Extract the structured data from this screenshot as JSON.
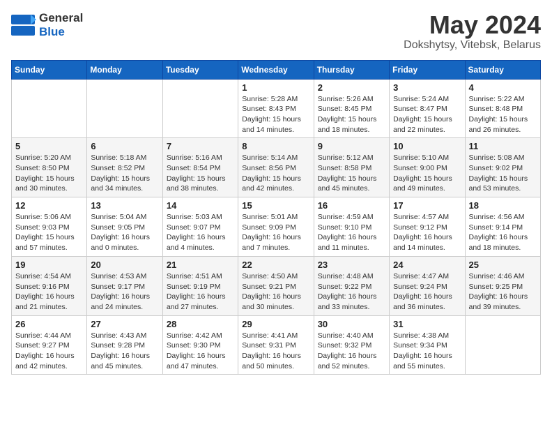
{
  "header": {
    "logo": {
      "general": "General",
      "blue": "Blue"
    },
    "title": "May 2024",
    "location": "Dokshytsy, Vitebsk, Belarus"
  },
  "calendar": {
    "weekdays": [
      "Sunday",
      "Monday",
      "Tuesday",
      "Wednesday",
      "Thursday",
      "Friday",
      "Saturday"
    ],
    "weeks": [
      [
        {
          "day": "",
          "info": ""
        },
        {
          "day": "",
          "info": ""
        },
        {
          "day": "",
          "info": ""
        },
        {
          "day": "1",
          "info": "Sunrise: 5:28 AM\nSunset: 8:43 PM\nDaylight: 15 hours\nand 14 minutes."
        },
        {
          "day": "2",
          "info": "Sunrise: 5:26 AM\nSunset: 8:45 PM\nDaylight: 15 hours\nand 18 minutes."
        },
        {
          "day": "3",
          "info": "Sunrise: 5:24 AM\nSunset: 8:47 PM\nDaylight: 15 hours\nand 22 minutes."
        },
        {
          "day": "4",
          "info": "Sunrise: 5:22 AM\nSunset: 8:48 PM\nDaylight: 15 hours\nand 26 minutes."
        }
      ],
      [
        {
          "day": "5",
          "info": "Sunrise: 5:20 AM\nSunset: 8:50 PM\nDaylight: 15 hours\nand 30 minutes."
        },
        {
          "day": "6",
          "info": "Sunrise: 5:18 AM\nSunset: 8:52 PM\nDaylight: 15 hours\nand 34 minutes."
        },
        {
          "day": "7",
          "info": "Sunrise: 5:16 AM\nSunset: 8:54 PM\nDaylight: 15 hours\nand 38 minutes."
        },
        {
          "day": "8",
          "info": "Sunrise: 5:14 AM\nSunset: 8:56 PM\nDaylight: 15 hours\nand 42 minutes."
        },
        {
          "day": "9",
          "info": "Sunrise: 5:12 AM\nSunset: 8:58 PM\nDaylight: 15 hours\nand 45 minutes."
        },
        {
          "day": "10",
          "info": "Sunrise: 5:10 AM\nSunset: 9:00 PM\nDaylight: 15 hours\nand 49 minutes."
        },
        {
          "day": "11",
          "info": "Sunrise: 5:08 AM\nSunset: 9:02 PM\nDaylight: 15 hours\nand 53 minutes."
        }
      ],
      [
        {
          "day": "12",
          "info": "Sunrise: 5:06 AM\nSunset: 9:03 PM\nDaylight: 15 hours\nand 57 minutes."
        },
        {
          "day": "13",
          "info": "Sunrise: 5:04 AM\nSunset: 9:05 PM\nDaylight: 16 hours\nand 0 minutes."
        },
        {
          "day": "14",
          "info": "Sunrise: 5:03 AM\nSunset: 9:07 PM\nDaylight: 16 hours\nand 4 minutes."
        },
        {
          "day": "15",
          "info": "Sunrise: 5:01 AM\nSunset: 9:09 PM\nDaylight: 16 hours\nand 7 minutes."
        },
        {
          "day": "16",
          "info": "Sunrise: 4:59 AM\nSunset: 9:10 PM\nDaylight: 16 hours\nand 11 minutes."
        },
        {
          "day": "17",
          "info": "Sunrise: 4:57 AM\nSunset: 9:12 PM\nDaylight: 16 hours\nand 14 minutes."
        },
        {
          "day": "18",
          "info": "Sunrise: 4:56 AM\nSunset: 9:14 PM\nDaylight: 16 hours\nand 18 minutes."
        }
      ],
      [
        {
          "day": "19",
          "info": "Sunrise: 4:54 AM\nSunset: 9:16 PM\nDaylight: 16 hours\nand 21 minutes."
        },
        {
          "day": "20",
          "info": "Sunrise: 4:53 AM\nSunset: 9:17 PM\nDaylight: 16 hours\nand 24 minutes."
        },
        {
          "day": "21",
          "info": "Sunrise: 4:51 AM\nSunset: 9:19 PM\nDaylight: 16 hours\nand 27 minutes."
        },
        {
          "day": "22",
          "info": "Sunrise: 4:50 AM\nSunset: 9:21 PM\nDaylight: 16 hours\nand 30 minutes."
        },
        {
          "day": "23",
          "info": "Sunrise: 4:48 AM\nSunset: 9:22 PM\nDaylight: 16 hours\nand 33 minutes."
        },
        {
          "day": "24",
          "info": "Sunrise: 4:47 AM\nSunset: 9:24 PM\nDaylight: 16 hours\nand 36 minutes."
        },
        {
          "day": "25",
          "info": "Sunrise: 4:46 AM\nSunset: 9:25 PM\nDaylight: 16 hours\nand 39 minutes."
        }
      ],
      [
        {
          "day": "26",
          "info": "Sunrise: 4:44 AM\nSunset: 9:27 PM\nDaylight: 16 hours\nand 42 minutes."
        },
        {
          "day": "27",
          "info": "Sunrise: 4:43 AM\nSunset: 9:28 PM\nDaylight: 16 hours\nand 45 minutes."
        },
        {
          "day": "28",
          "info": "Sunrise: 4:42 AM\nSunset: 9:30 PM\nDaylight: 16 hours\nand 47 minutes."
        },
        {
          "day": "29",
          "info": "Sunrise: 4:41 AM\nSunset: 9:31 PM\nDaylight: 16 hours\nand 50 minutes."
        },
        {
          "day": "30",
          "info": "Sunrise: 4:40 AM\nSunset: 9:32 PM\nDaylight: 16 hours\nand 52 minutes."
        },
        {
          "day": "31",
          "info": "Sunrise: 4:38 AM\nSunset: 9:34 PM\nDaylight: 16 hours\nand 55 minutes."
        },
        {
          "day": "",
          "info": ""
        }
      ]
    ]
  }
}
